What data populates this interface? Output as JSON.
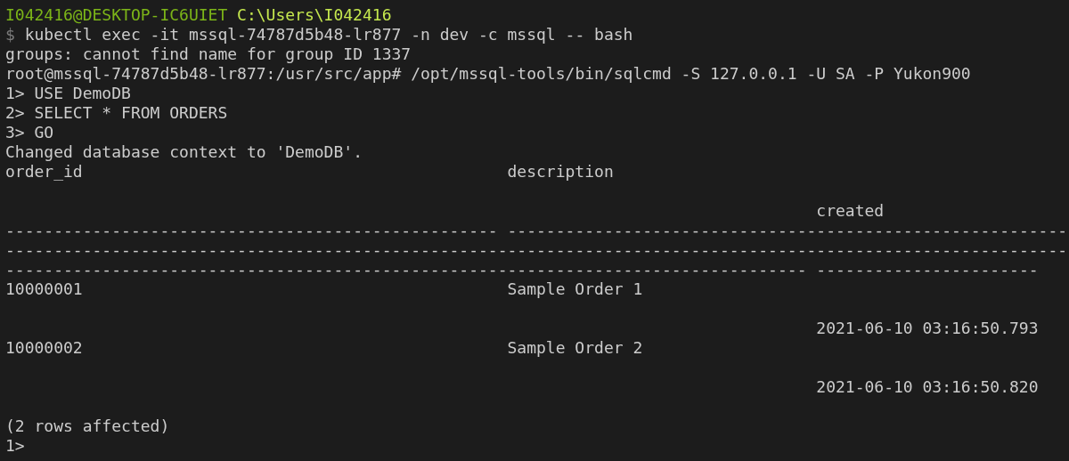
{
  "prompt": {
    "user_host": "I042416@DESKTOP-IC6UIET",
    "path": "C:\\Users\\I042416"
  },
  "command": {
    "symbol": "$",
    "text": "kubectl exec -it mssql-74787d5b48-lr877 -n dev -c mssql -- bash"
  },
  "output_lines": [
    "groups: cannot find name for group ID 1337",
    "root@mssql-74787d5b48-lr877:/usr/src/app# /opt/mssql-tools/bin/sqlcmd -S 127.0.0.1 -U SA -P Yukon900",
    "1> USE DemoDB",
    "2> SELECT * FROM ORDERS",
    "3> GO",
    "Changed database context to 'DemoDB'."
  ],
  "result_table": {
    "columns": [
      "order_id",
      "description",
      "created"
    ],
    "separator_lines": [
      "--------------------------------------------------- ----------------------------------------------------------",
      "--------------------------------------------------------------------------------------------------------------",
      "----------------------------------------------------------------------------------- -----------------------"
    ],
    "rows": [
      [
        "10000001",
        "Sample Order 1",
        "2021-06-10 03:16:50.793"
      ],
      [
        "10000002",
        "Sample Order 2",
        "2021-06-10 03:16:50.820"
      ]
    ]
  },
  "footer_lines": [
    "(2 rows affected)",
    "1>"
  ]
}
